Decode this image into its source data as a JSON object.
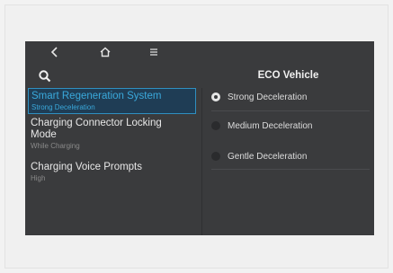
{
  "topbar": {
    "back_icon": "chevron-left-icon",
    "home_icon": "home-icon",
    "menu_icon": "menu-icon"
  },
  "search_icon": "search-icon",
  "menu": {
    "items": [
      {
        "title": "Smart Regeneration System",
        "subtitle": "Strong Deceleration",
        "selected": true
      },
      {
        "title": "Charging Connector Locking Mode",
        "subtitle": "While Charging",
        "selected": false
      },
      {
        "title": "Charging Voice Prompts",
        "subtitle": "High",
        "selected": false
      }
    ]
  },
  "right": {
    "title": "ECO Vehicle",
    "options": [
      {
        "label": "Strong Deceleration",
        "selected": true
      },
      {
        "label": "Medium Deceleration",
        "selected": false
      },
      {
        "label": "Gentle Deceleration",
        "selected": false
      }
    ]
  },
  "colors": {
    "screen_bg": "#3a3b3d",
    "accent": "#3aa9dc",
    "highlight_bg": "#1f3d55"
  }
}
